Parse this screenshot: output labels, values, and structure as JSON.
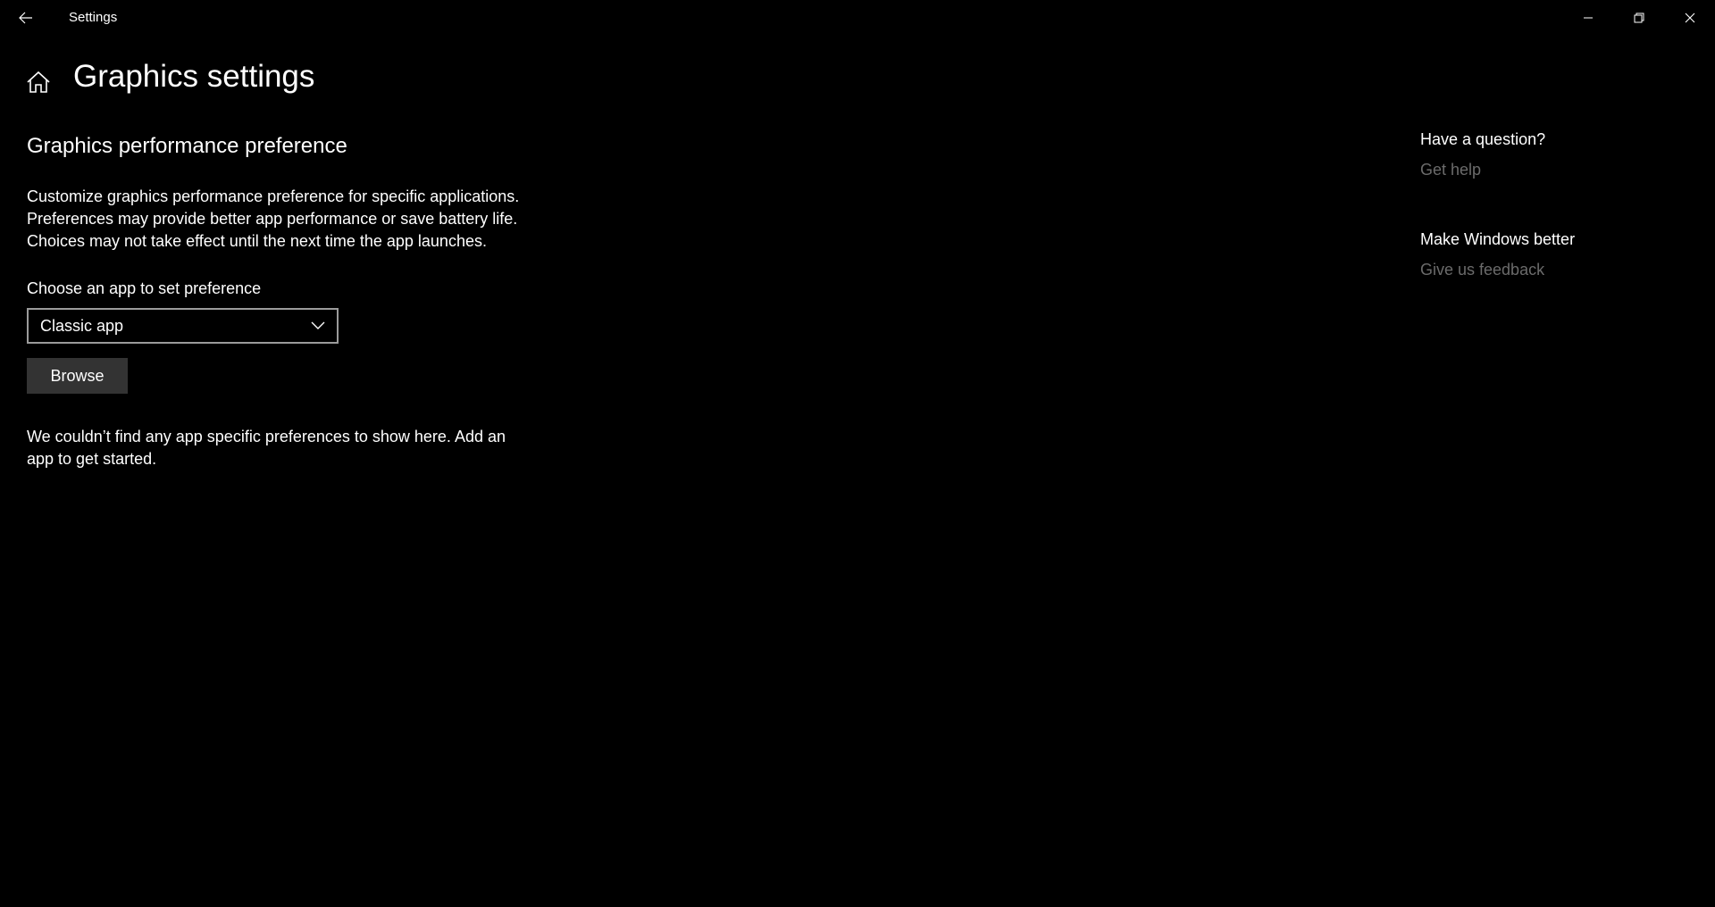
{
  "window": {
    "title": "Settings",
    "back_icon": "arrow-left-icon",
    "controls": {
      "minimize_icon": "minimize-icon",
      "restore_icon": "restore-icon",
      "close_icon": "close-icon"
    }
  },
  "header": {
    "home_icon": "home-icon",
    "title": "Graphics settings"
  },
  "main": {
    "section_title": "Graphics performance preference",
    "description": "Customize graphics performance preference for specific applications. Preferences may provide better app performance or save battery life. Choices may not take effect until the next time the app launches.",
    "choose_label": "Choose an app to set preference",
    "app_type_select": {
      "selected": "Classic app",
      "icon": "chevron-down-icon"
    },
    "browse_label": "Browse",
    "empty_message": "We couldn’t find any app specific preferences to show here. Add an app to get started."
  },
  "side": {
    "question_heading": "Have a question?",
    "get_help": "Get help",
    "feedback_heading": "Make Windows better",
    "give_feedback": "Give us feedback"
  },
  "colors": {
    "background": "#000000",
    "text": "#ffffff",
    "link_muted": "#6b6b6b",
    "button_bg": "#333333",
    "dropdown_border": "#9b9b9b"
  }
}
